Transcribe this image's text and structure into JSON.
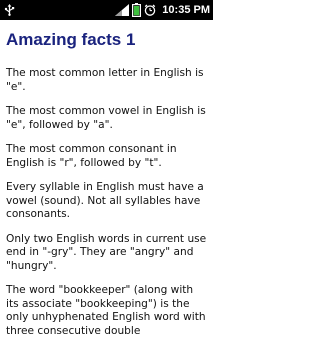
{
  "status_bar": {
    "time": "10:35 PM",
    "icons": [
      "usb-icon",
      "signal-strength-icon",
      "battery-icon",
      "alarm-icon"
    ],
    "background_color": "#000000"
  },
  "page": {
    "title": "Amazing facts 1",
    "title_color": "#1a237e",
    "facts": [
      "The most common letter in English is \"e\".",
      "The most common vowel in English is \"e\", followed by \"a\".",
      "The most common consonant in English is \"r\", followed by \"t\".",
      "Every syllable in English must have a vowel (sound). Not all syllables have consonants.",
      "Only two English words in current use end in \"-gry\". They are \"angry\" and \"hungry\".",
      "The word \"bookkeeper\" (along with its associate \"bookkeeping\") is the only unhyphenated English word with three consecutive double"
    ]
  }
}
